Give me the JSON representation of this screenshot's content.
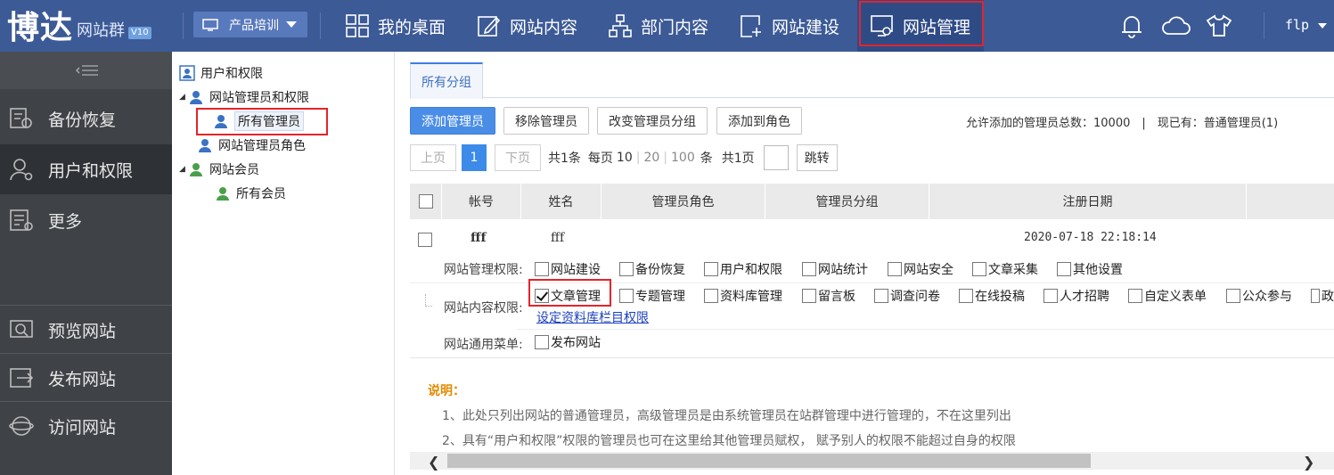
{
  "topbar": {
    "logo_text": "博达",
    "logo_sub": "网站群",
    "logo_version": "V10",
    "site_selector": "产品培训",
    "nav": [
      {
        "label": "我的桌面",
        "icon": "grid-icon"
      },
      {
        "label": "网站内容",
        "icon": "edit-icon"
      },
      {
        "label": "部门内容",
        "icon": "org-icon"
      },
      {
        "label": "网站建设",
        "icon": "add-page-icon"
      },
      {
        "label": "网站管理",
        "icon": "monitor-gear-icon",
        "active": true
      }
    ],
    "icons": [
      "bell-icon",
      "cloud-icon",
      "shirt-icon"
    ],
    "user": "flp"
  },
  "left_menu": {
    "items": [
      {
        "label": "备份恢复",
        "icon": "backup-icon"
      },
      {
        "label": "用户和权限",
        "icon": "user-gear-icon",
        "active": true
      },
      {
        "label": "更多",
        "icon": "more-list-icon"
      },
      {
        "label": "预览网站",
        "icon": "preview-icon"
      },
      {
        "label": "发布网站",
        "icon": "publish-icon"
      },
      {
        "label": "访问网站",
        "icon": "globe-icon"
      }
    ]
  },
  "tree": {
    "root": "用户和权限",
    "n1": "网站管理员和权限",
    "n1_1": "所有管理员",
    "n1_2": "网站管理员角色",
    "n2": "网站会员",
    "n2_1": "所有会员"
  },
  "content": {
    "tab": "所有分组",
    "buttons": {
      "add": "添加管理员",
      "remove": "移除管理员",
      "change_group": "改变管理员分组",
      "add_role": "添加到角色"
    },
    "quota_text": "允许添加的管理员总数：10000　|　现已有：普通管理员(1)",
    "pager": {
      "prev": "上页",
      "current": "1",
      "next": "下页",
      "total": "共1条",
      "per_page_label": "每页",
      "per_page_options": [
        "10",
        "20",
        "100"
      ],
      "unit": "条",
      "pages": "共1页",
      "go": "跳转"
    },
    "table": {
      "headers": [
        "帐号",
        "姓名",
        "管理员角色",
        "管理员分组",
        "注册日期"
      ],
      "row": {
        "account": "fff",
        "name": "fff",
        "date": "2020-07-18 22:18:14"
      }
    },
    "permissions": {
      "site_mgmt_label": "网站管理权限:",
      "site_mgmt": [
        "网站建设",
        "备份恢复",
        "用户和权限",
        "网站统计",
        "网站安全",
        "文章采集",
        "其他设置"
      ],
      "site_content_label": "网站内容权限:",
      "site_content": [
        "文章管理",
        "专题管理",
        "资料库管理",
        "留言板",
        "调查问卷",
        "在线投稿",
        "人才招聘",
        "自定义表单",
        "公众参与",
        "政"
      ],
      "site_content_checked": "文章管理",
      "db_link": "设定资料库栏目权限",
      "common_label": "网站通用菜单:",
      "common": [
        "发布网站"
      ]
    },
    "notes": {
      "head": "说明：",
      "line1": "1、此处只列出网站的普通管理员，高级管理员是由系统管理员在站群管理中进行管理的，不在这里列出",
      "line2": "2、具有“用户和权限”权限的管理员也可在这里给其他管理员赋权，  赋予别人的权限不能超过自身的权限"
    }
  }
}
